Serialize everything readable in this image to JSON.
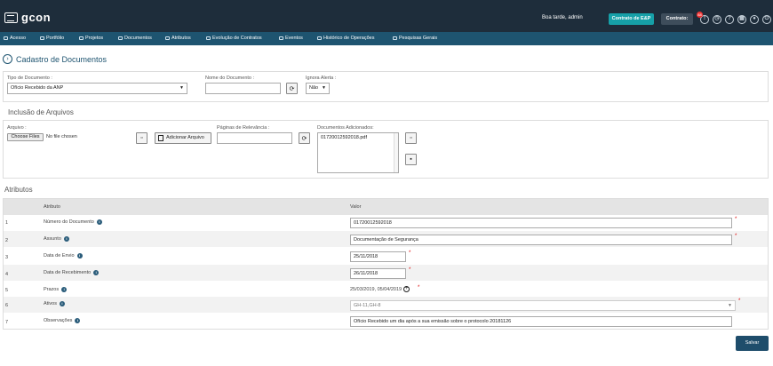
{
  "header": {
    "app_name": "gcon",
    "greeting": "Boa tarde, admin",
    "contract_button": "Contrato de E&P",
    "contrato_label": "Contrato:",
    "notification_count": "88"
  },
  "nav": {
    "items": [
      {
        "label": "Acesso"
      },
      {
        "label": "Portfólio"
      },
      {
        "label": "Projetos"
      },
      {
        "label": "Documentos"
      },
      {
        "label": "Atributos"
      },
      {
        "label": "Evolução de Contratos"
      },
      {
        "label": "Eventos"
      },
      {
        "label": "Histórico de Operações"
      },
      {
        "label": "Pesquisas Gerais"
      }
    ]
  },
  "page": {
    "title": "Cadastro de Documentos"
  },
  "form": {
    "tipo_label": "Tipo de Documento :",
    "tipo_value": "Ofício Recebido da ANP",
    "nome_label": "Nome do Documento :",
    "nome_value": "",
    "alerta_label": "Ignora Alerta :",
    "alerta_value": "Não"
  },
  "inclusao": {
    "title": "Inclusão de Arquivos",
    "arquivo_label": "Arquivo :",
    "choose_files": "Choose Files",
    "no_file": "No file chosen",
    "add_button": "Adicionar Arquivo",
    "paginas_label": "Páginas de Relevância :",
    "paginas_value": "",
    "docs_label": "Documentos Adicionados:",
    "docs_items": [
      "01720012592018.pdf"
    ]
  },
  "atributos": {
    "title": "Atributos",
    "col_atributo": "Atributo",
    "col_valor": "Valor",
    "rows": [
      {
        "num": "1",
        "name": "Número do Documento",
        "value": "01720012592018"
      },
      {
        "num": "2",
        "name": "Assunto",
        "value": "Documentação de Segurança"
      },
      {
        "num": "3",
        "name": "Data de Envio",
        "value": "25/11/2018"
      },
      {
        "num": "4",
        "name": "Data de Recebimento",
        "value": "26/11/2018"
      },
      {
        "num": "5",
        "name": "Prazos",
        "value": "25/03/2019, 05/04/2019"
      },
      {
        "num": "6",
        "name": "Ativos",
        "value": "GH-11,GH-8"
      },
      {
        "num": "7",
        "name": "Observações",
        "value": "Ofício Recebido um dia após a sua emissão sobre o protocolo 20181126"
      }
    ]
  },
  "actions": {
    "save": "Salvar"
  }
}
